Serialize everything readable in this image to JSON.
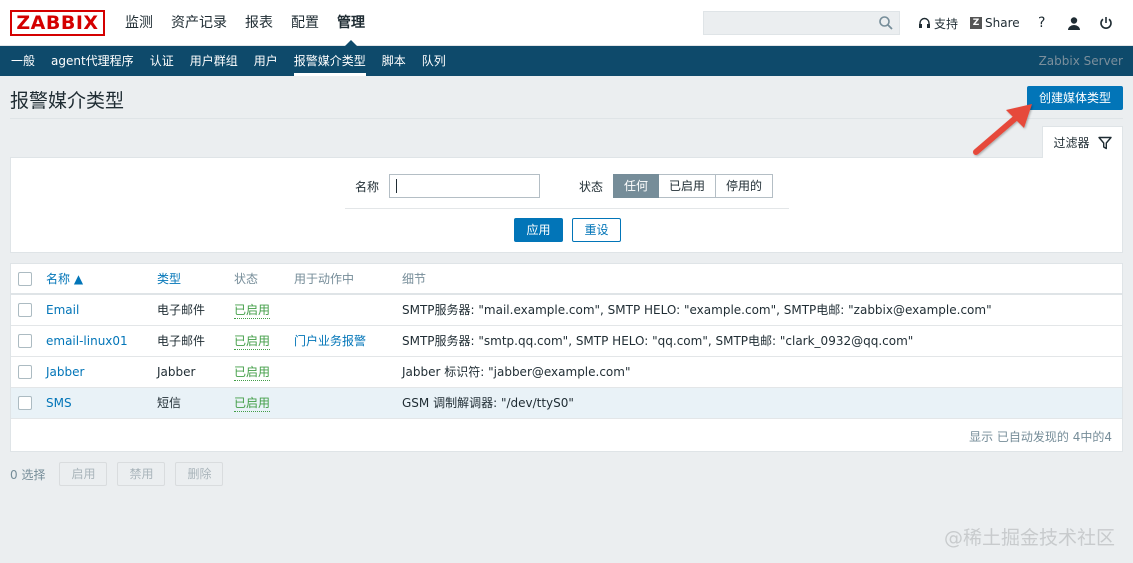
{
  "logo": "ZABBIX",
  "main_nav": [
    "监测",
    "资产记录",
    "报表",
    "配置",
    "管理"
  ],
  "main_nav_active": "管理",
  "search": {
    "placeholder": ""
  },
  "tools": {
    "support": "支持",
    "share": "Share",
    "help": "?"
  },
  "sub_nav": [
    "一般",
    "agent代理程序",
    "认证",
    "用户群组",
    "用户",
    "报警媒介类型",
    "脚本",
    "队列"
  ],
  "sub_nav_active": "报警媒介类型",
  "server_name": "Zabbix Server",
  "page_title": "报警媒介类型",
  "create_button": "创建媒体类型",
  "filter": {
    "tab_label": "过滤器",
    "name_label": "名称",
    "name_value": "",
    "status_label": "状态",
    "status_options": [
      "任何",
      "已启用",
      "停用的"
    ],
    "status_selected": "任何",
    "apply": "应用",
    "reset": "重设"
  },
  "table": {
    "headers": {
      "name": "名称 ▲",
      "type": "类型",
      "status": "状态",
      "used_in": "用于动作中",
      "details": "细节"
    },
    "rows": [
      {
        "name": "Email",
        "type": "电子邮件",
        "status": "已启用",
        "used_in": "",
        "details": "SMTP服务器: \"mail.example.com\", SMTP HELO: \"example.com\", SMTP电邮: \"zabbix@example.com\""
      },
      {
        "name": "email-linux01",
        "type": "电子邮件",
        "status": "已启用",
        "used_in": "门户业务报警",
        "details": "SMTP服务器: \"smtp.qq.com\", SMTP HELO: \"qq.com\", SMTP电邮: \"clark_0932@qq.com\""
      },
      {
        "name": "Jabber",
        "type": "Jabber",
        "status": "已启用",
        "used_in": "",
        "details": "Jabber 标识符: \"jabber@example.com\""
      },
      {
        "name": "SMS",
        "type": "短信",
        "status": "已启用",
        "used_in": "",
        "details": "GSM 调制解调器: \"/dev/ttyS0\""
      }
    ],
    "summary": "显示 已自动发现的 4中的4"
  },
  "bottom": {
    "selected": "0 选择",
    "enable": "启用",
    "disable": "禁用",
    "delete": "删除"
  },
  "watermark": "@稀土掘金技术社区",
  "colors": {
    "nav_bg": "#0e4a6b",
    "accent": "#0275b8",
    "enabled": "#429e47",
    "logo": "#d40000",
    "annotation_arrow": "#e64a3b"
  }
}
